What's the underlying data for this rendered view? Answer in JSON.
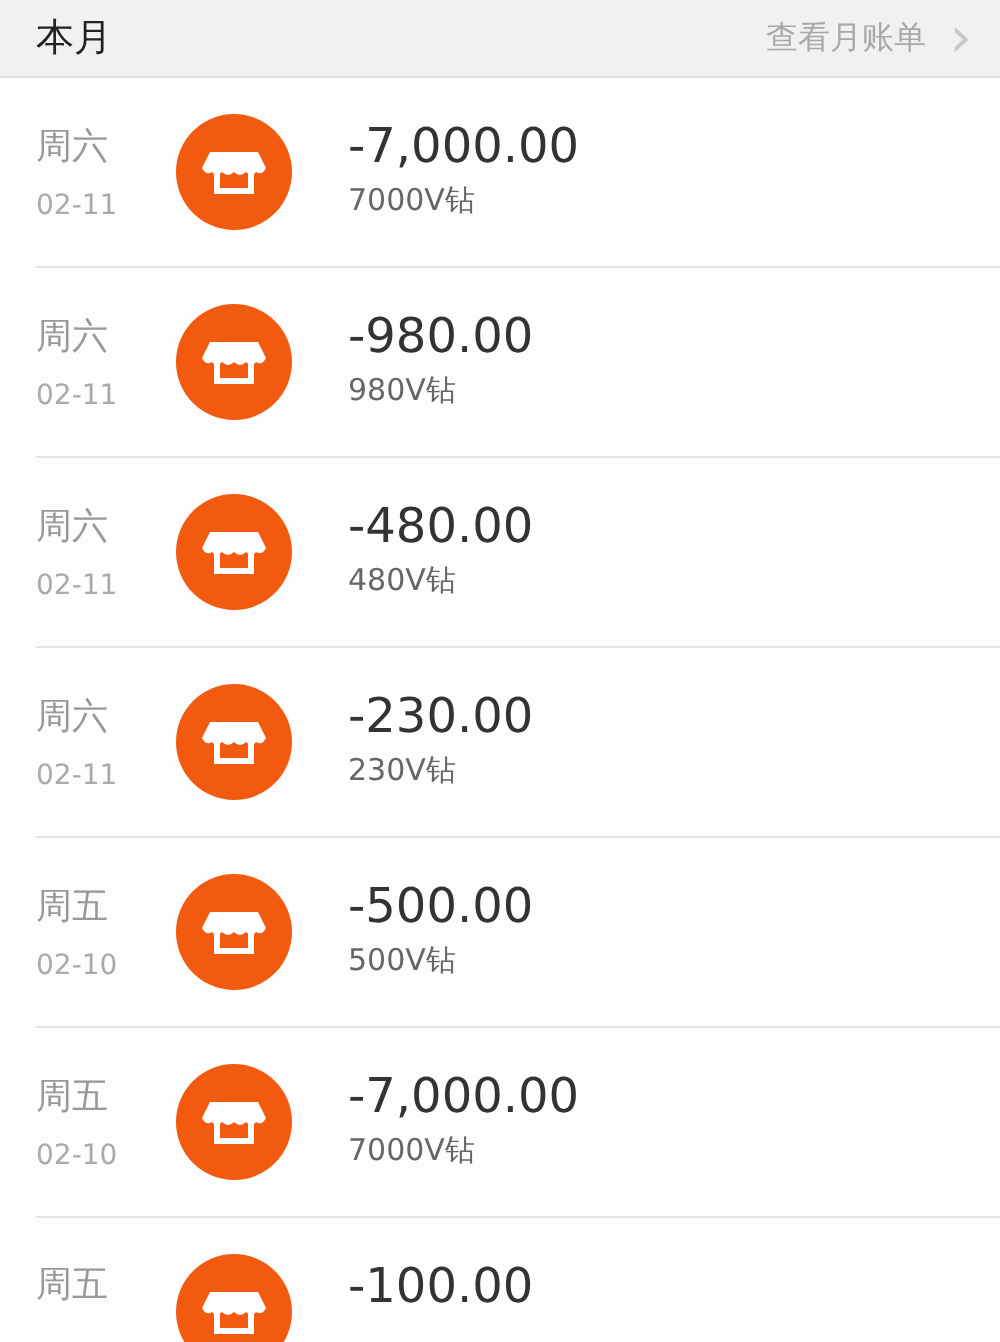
{
  "header": {
    "title": "本月",
    "link": "查看月账单",
    "chevron": "›"
  },
  "records": [
    {
      "weekday": "周六",
      "date": "02-11",
      "amount": "-7,000.00",
      "description": "7000V钻"
    },
    {
      "weekday": "周六",
      "date": "02-11",
      "amount": "-980.00",
      "description": "980V钻"
    },
    {
      "weekday": "周六",
      "date": "02-11",
      "amount": "-480.00",
      "description": "480V钻"
    },
    {
      "weekday": "周六",
      "date": "02-11",
      "amount": "-230.00",
      "description": "230V钻"
    },
    {
      "weekday": "周五",
      "date": "02-10",
      "amount": "-500.00",
      "description": "500V钻"
    },
    {
      "weekday": "周五",
      "date": "02-10",
      "amount": "-7,000.00",
      "description": "7000V钻"
    },
    {
      "weekday": "周五",
      "amount": "-100.00"
    }
  ]
}
